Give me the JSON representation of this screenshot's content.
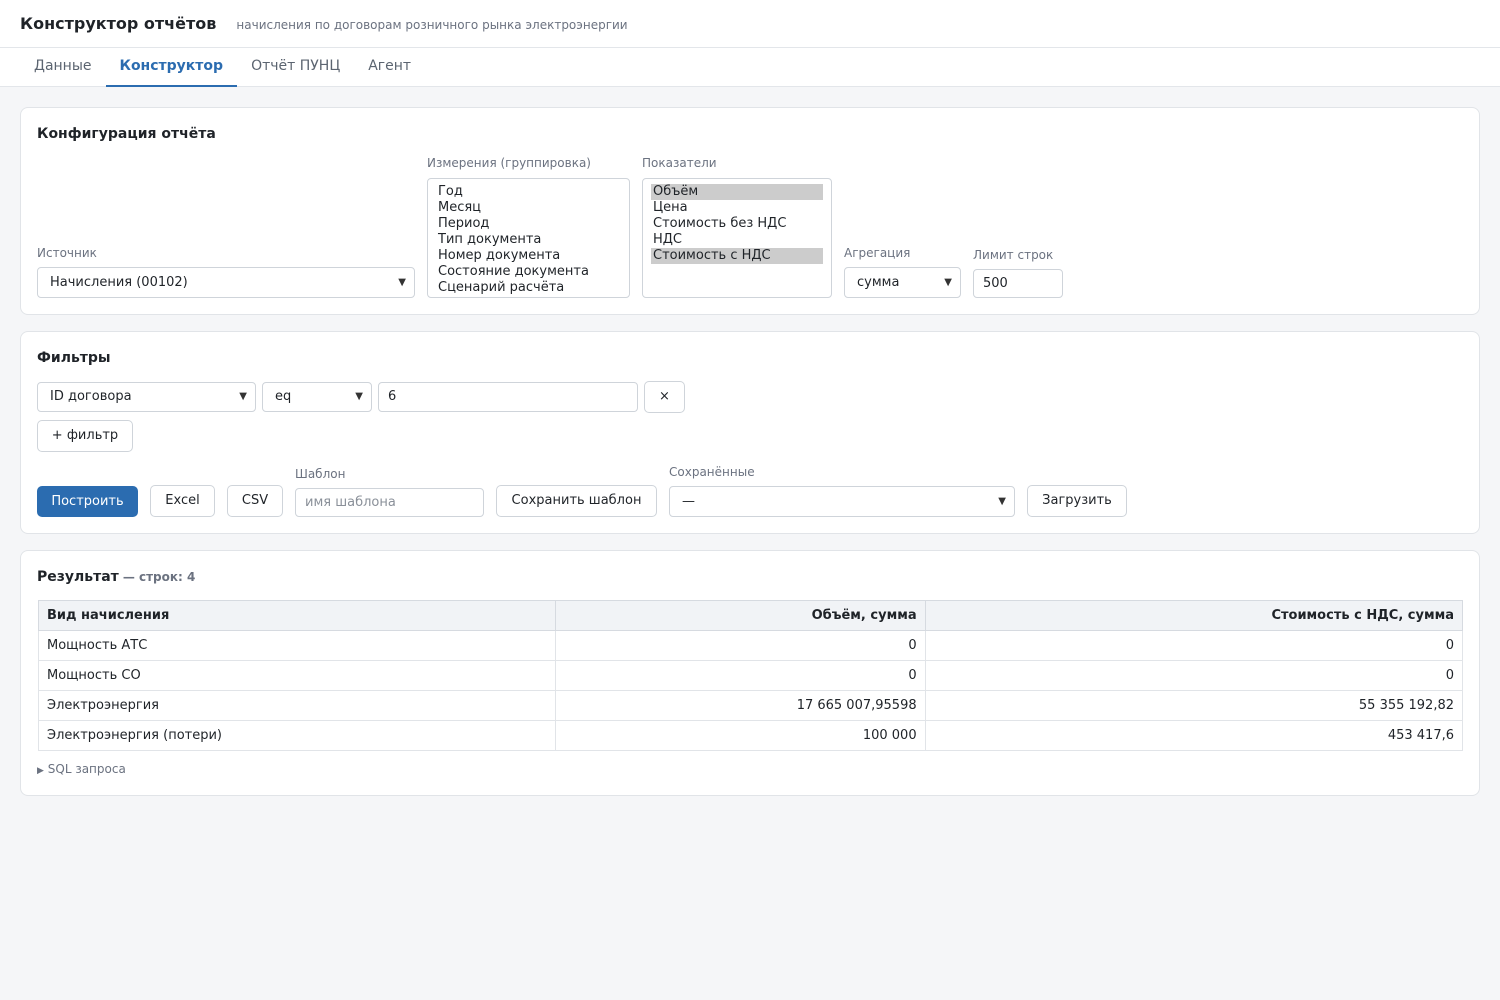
{
  "header": {
    "title": "Конструктор отчётов",
    "subtitle": "начисления по договорам розничного рынка электроэнергии"
  },
  "tabs": [
    {
      "label": "Данные"
    },
    {
      "label": "Конструктор",
      "active": true
    },
    {
      "label": "Отчёт ПУНЦ"
    },
    {
      "label": "Агент"
    }
  ],
  "config": {
    "title": "Конфигурация отчёта",
    "source": {
      "label": "Источник",
      "value": "Начисления (00102)"
    },
    "dimensions": {
      "label": "Измерения (группировка)",
      "options": [
        "Год",
        "Месяц",
        "Период",
        "Тип документа",
        "Номер документа",
        "Состояние документа",
        "Сценарий расчёта"
      ]
    },
    "metrics": {
      "label": "Показатели",
      "options": [
        {
          "text": "Объём",
          "selected": true
        },
        {
          "text": "Цена",
          "selected": false
        },
        {
          "text": "Стоимость без НДС",
          "selected": false
        },
        {
          "text": "НДС",
          "selected": false
        },
        {
          "text": "Стоимость с НДС",
          "selected": true
        }
      ]
    },
    "aggregation": {
      "label": "Агрегация",
      "value": "сумма"
    },
    "limit": {
      "label": "Лимит строк",
      "value": "500"
    }
  },
  "filters": {
    "title": "Фильтры",
    "row": {
      "field": "ID договора",
      "op": "eq",
      "value": "6",
      "remove": "×"
    },
    "add_label": "+ фильтр",
    "build_label": "Построить",
    "excel_label": "Excel",
    "csv_label": "CSV",
    "template": {
      "label": "Шаблон",
      "placeholder": "имя шаблона"
    },
    "save_template_label": "Сохранить шаблон",
    "saved": {
      "label": "Сохранённые",
      "value": "—"
    },
    "load_label": "Загрузить"
  },
  "result": {
    "title": "Результат",
    "count": "— строк: 4",
    "columns": [
      "Вид начисления",
      "Объём, сумма",
      "Стоимость с НДС, сумма"
    ],
    "rows": [
      [
        "Мощность АТС",
        "0",
        "0"
      ],
      [
        "Мощность СО",
        "0",
        "0"
      ],
      [
        "Электроэнергия",
        "17 665 007,95598",
        "55 355 192,82"
      ],
      [
        "Электроэнергия (потери)",
        "100 000",
        "453 417,6"
      ]
    ],
    "sql_label": "SQL запроса",
    "sql_icon": "triangle-right-icon"
  },
  "colors": {
    "accent": "#2b6cb0",
    "background": "#f5f6f8"
  }
}
